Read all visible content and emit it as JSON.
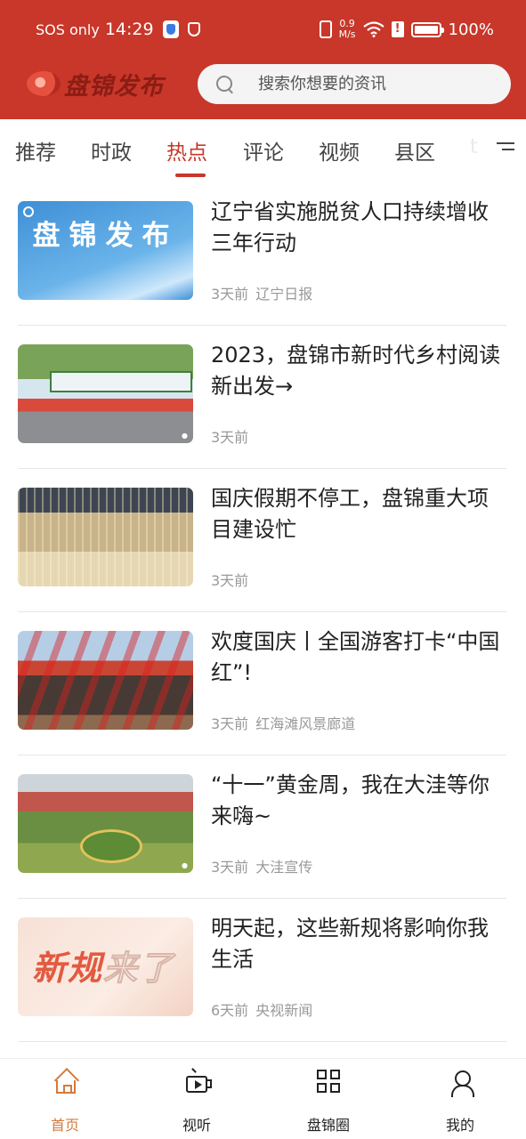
{
  "status_bar": {
    "carrier": "SOS only",
    "time": "14:29",
    "net_speed_value": "0.9",
    "net_speed_unit": "M/s",
    "battery": "100%"
  },
  "header": {
    "brand": "盘锦发布",
    "search_placeholder": "搜索你想要的资讯"
  },
  "tabs": {
    "items": [
      "推荐",
      "时政",
      "热点",
      "评论",
      "视频",
      "县区",
      "t"
    ],
    "active_index": 2
  },
  "feed": [
    {
      "title": "辽宁省实施脱贫人口持续增收三年行动",
      "time": "3天前",
      "source": "辽宁日报",
      "thumb_text": "盘锦发布"
    },
    {
      "title": "2023，盘锦市新时代乡村阅读新出发→",
      "time": "3天前",
      "source": ""
    },
    {
      "title": "国庆假期不停工，盘锦重大项目建设忙",
      "time": "3天前",
      "source": ""
    },
    {
      "title": "欢度国庆丨全国游客打卡“中国红”!",
      "time": "3天前",
      "source": "红海滩风景廊道"
    },
    {
      "title": "“十一”黄金周，我在大洼等你来嗨~",
      "time": "3天前",
      "source": "大洼宣传"
    },
    {
      "title": "明天起，这些新规将影响你我生活",
      "time": "6天前",
      "source": "央视新闻",
      "thumb_text_a": "新规",
      "thumb_text_b": "来了"
    }
  ],
  "bottom_nav": {
    "items": [
      "首页",
      "视听",
      "盘锦圈",
      "我的"
    ],
    "active_index": 0
  },
  "colors": {
    "brand_red": "#c8372a",
    "nav_active": "#d47a3c"
  }
}
